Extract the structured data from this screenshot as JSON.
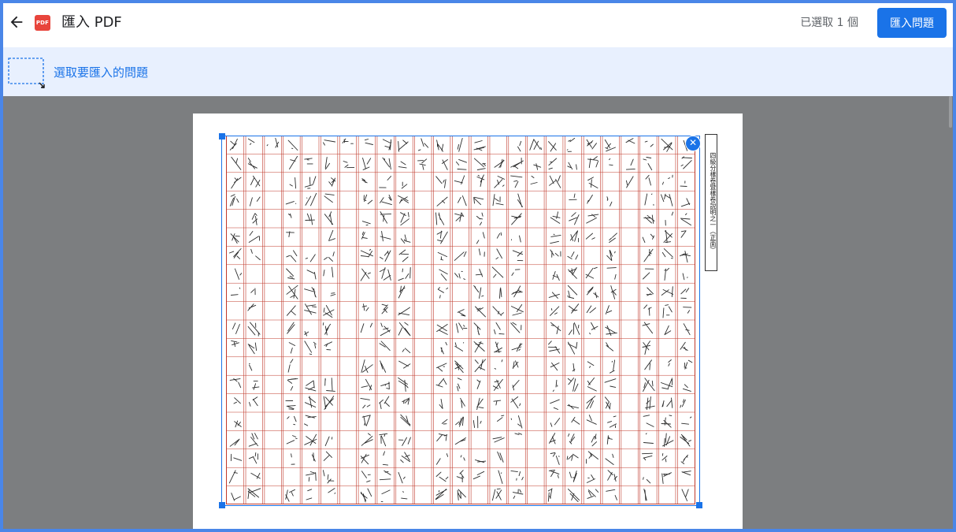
{
  "header": {
    "title": "匯入 PDF",
    "pdf_badge": "PDF",
    "selected_count": "已選取 1 個",
    "import_button": "匯入問題"
  },
  "instruction": {
    "text": "選取要匯入的問題"
  },
  "document": {
    "side_label": "四級分樣卷暨樣卷說明之一（正面）"
  },
  "colors": {
    "accent": "#1a73e8",
    "instruction_bg": "#e8f0fe",
    "viewer_bg": "#7c7e80",
    "grid_line": "#c0392b",
    "pdf_badge": "#e8453c"
  },
  "icons": {
    "back": "arrow-left-icon",
    "pdf": "pdf-file-icon",
    "select_area": "select-area-icon",
    "remove_selection": "close-circle-icon"
  }
}
